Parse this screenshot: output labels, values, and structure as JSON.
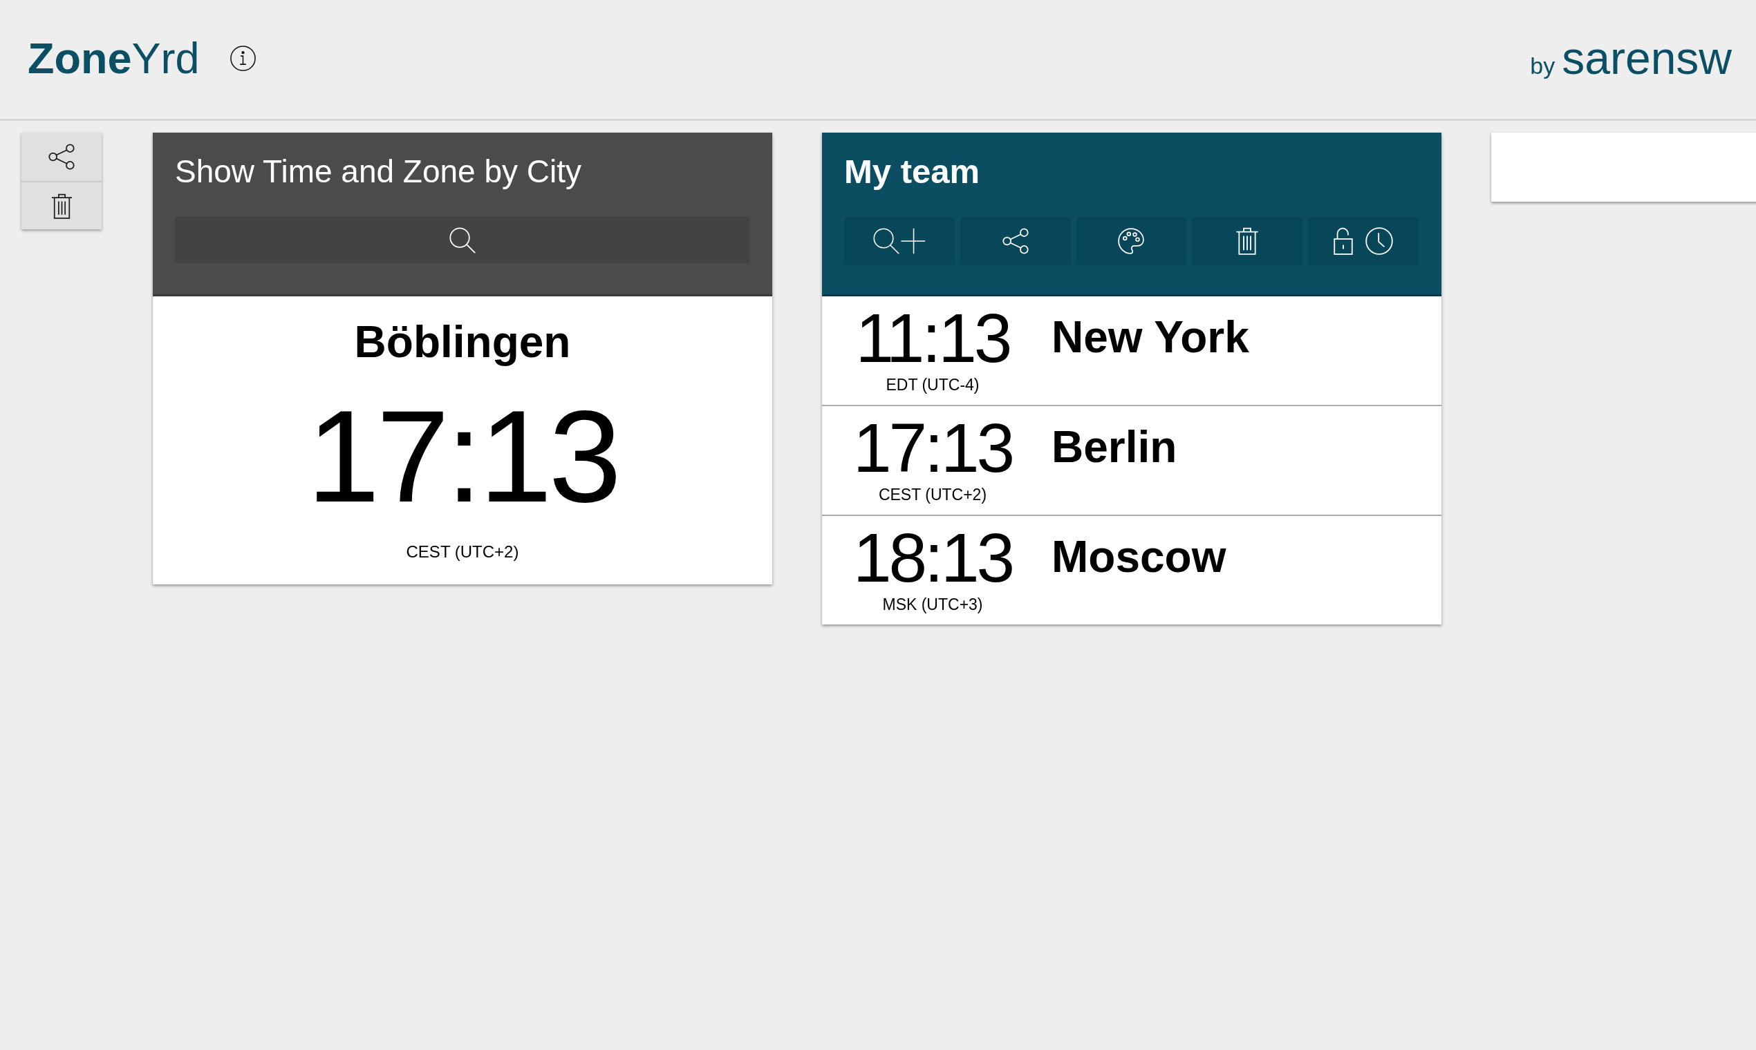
{
  "header": {
    "logo": "**Zone**Yrd",
    "byline": "by",
    "brand": "sarensw"
  },
  "city_card": {
    "title": "Show Time and Zone by City",
    "city": "Böblingen",
    "time": "17:13",
    "zone": "CEST (UTC+2)"
  },
  "team_card": {
    "title": "My team",
    "rows": [
      {
        "time": "11:13",
        "zone": "EDT (UTC-4)",
        "city": "New York"
      },
      {
        "time": "17:13",
        "zone": "CEST (UTC+2)",
        "city": "Berlin"
      },
      {
        "time": "18:13",
        "zone": "MSK (UTC+3)",
        "city": "Moscow"
      }
    ]
  }
}
